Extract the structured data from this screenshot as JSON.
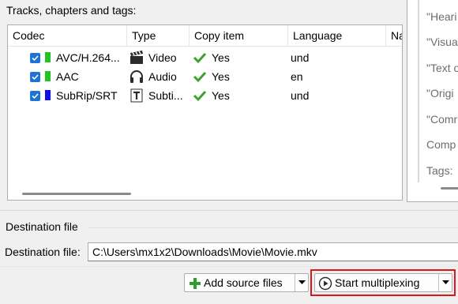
{
  "tracks_group": {
    "title": "Tracks, chapters and tags:",
    "columns": [
      "Codec",
      "Type",
      "Copy item",
      "Language",
      "Na"
    ],
    "rows": [
      {
        "codec": "AVC/H.264...",
        "type": "Video",
        "copy": "Yes",
        "language": "und",
        "color": "#22c322",
        "icon": "clapperboard-icon"
      },
      {
        "codec": "AAC",
        "type": "Audio",
        "copy": "Yes",
        "language": "en",
        "color": "#22c322",
        "icon": "headphones-icon"
      },
      {
        "codec": "SubRip/SRT",
        "type": "Subti...",
        "copy": "Yes",
        "language": "und",
        "color": "#1010e6",
        "icon": "text-t-icon"
      }
    ]
  },
  "properties_panel": {
    "items": [
      "\"Heari",
      "\"Visua",
      "\"Text o",
      "\"Origi",
      "\"Comr",
      "Comp",
      "Tags:"
    ]
  },
  "destination": {
    "section_title": "Destination file",
    "label": "Destination file:",
    "path": "C:\\Users\\mx1x2\\Downloads\\Movie\\Movie.mkv"
  },
  "buttons": {
    "add_source": "Add source files",
    "start_mux": "Start multiplexing"
  },
  "colors": {
    "checkbox": "#1e73d9",
    "checkmark_green": "#3aa52b",
    "highlight": "#e0141b"
  }
}
